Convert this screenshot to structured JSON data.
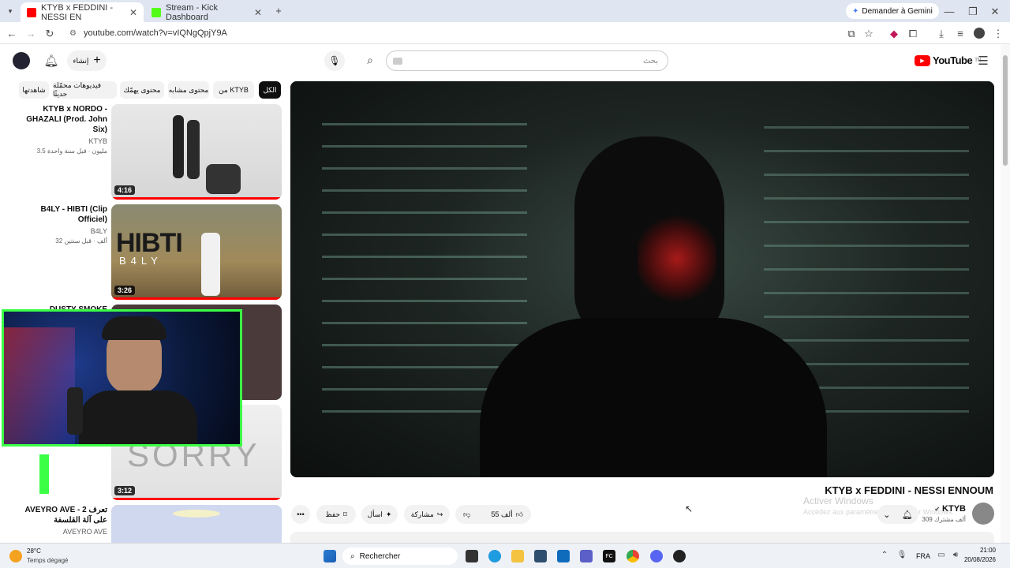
{
  "browser": {
    "tabs": [
      {
        "label": "KTYB x FEDDINI - NESSI EN",
        "active": true
      },
      {
        "label": "Stream - Kick Dashboard",
        "active": false
      }
    ],
    "gemini_label": "Demander à Gemini",
    "url": "youtube.com/watch?v=vIQNgQpjY9A"
  },
  "youtube": {
    "logo_text": "YouTube",
    "logo_sup": "TN",
    "search_placeholder": "بحث",
    "create_label": "إنشاء",
    "chips": [
      "الكل",
      "من KTYB",
      "محتوى مشابه",
      "محتوى يهمّك",
      "فيديوهات محمّلة حديثًا",
      "شاهدتها"
    ],
    "recommendations": [
      {
        "title": "KTYB x NORDO - GHAZALI (Prod. John Six)",
        "channel": "KTYB",
        "stats": "3.5 مليون · قبل سنة واحدة",
        "duration": "4:16"
      },
      {
        "title": "B4LY - HIBTI (Clip Officiel)",
        "channel": "B4LY",
        "stats": "32 ألف · قبل سنتين",
        "duration": "3:26"
      },
      {
        "title": "DUSTY SMOKE",
        "channel": "",
        "stats": "",
        "duration": ""
      },
      {
        "title": "",
        "channel": "",
        "stats": "",
        "duration": "3:12"
      },
      {
        "title": "AVEYRO AVE - 2 تعرف على آلة القلسفة",
        "channel": "AVEYRO AVE",
        "stats": "",
        "duration": ""
      }
    ],
    "video": {
      "title": "KTYB x FEDDINI - NESSI ENNOUM",
      "channel": "KTYB",
      "subscribers": "309 ألف مشترك",
      "likes": "55 ألف",
      "share_label": "مشاركة",
      "ask_label": "اسأل",
      "save_label": "حفظ"
    },
    "watermark_line1": "Activer Windows",
    "watermark_line2": "Accédez aux paramètres pour activer Windows."
  },
  "taskbar": {
    "weather_temp": "28°C",
    "weather_desc": "Temps dégagé",
    "search_label": "Rechercher",
    "lang": "FRA",
    "time": "21:00",
    "date": "20/08/2026"
  },
  "colors": {
    "accent": "#ff0000",
    "cam_border": "#3bff45",
    "chip_active": "#0f0f0f"
  }
}
